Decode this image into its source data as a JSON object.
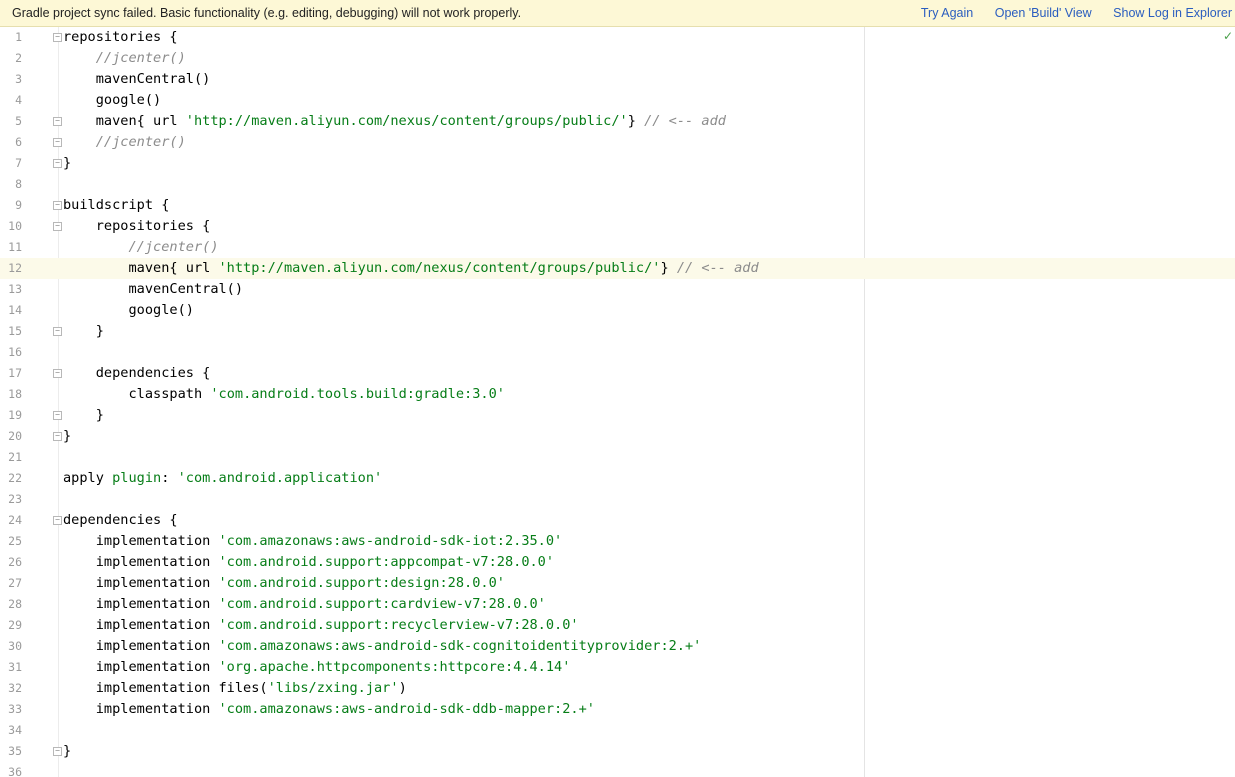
{
  "banner": {
    "message": "Gradle project sync failed. Basic functionality (e.g. editing, debugging) will not work properly.",
    "try_again": "Try Again",
    "open_build": "Open 'Build' View",
    "show_log": "Show Log in Explorer"
  },
  "editor": {
    "current_line": 12,
    "lines": [
      {
        "n": "1",
        "segs": [
          [
            "p",
            "repositories {"
          ]
        ]
      },
      {
        "n": "2",
        "segs": [
          [
            "p",
            "    "
          ],
          [
            "c",
            "//jcenter()"
          ]
        ]
      },
      {
        "n": "3",
        "segs": [
          [
            "p",
            "    mavenCentral()"
          ]
        ]
      },
      {
        "n": "4",
        "segs": [
          [
            "p",
            "    google()"
          ]
        ]
      },
      {
        "n": "5",
        "segs": [
          [
            "p",
            "    maven{ url "
          ],
          [
            "s",
            "'http://maven.aliyun.com/nexus/content/groups/public/'"
          ],
          [
            "p",
            "} "
          ],
          [
            "c",
            "// <-- add"
          ]
        ]
      },
      {
        "n": "6",
        "segs": [
          [
            "p",
            "    "
          ],
          [
            "c",
            "//jcenter()"
          ]
        ]
      },
      {
        "n": "7",
        "segs": [
          [
            "p",
            "}"
          ]
        ]
      },
      {
        "n": "8",
        "segs": []
      },
      {
        "n": "9",
        "segs": [
          [
            "p",
            "buildscript {"
          ]
        ]
      },
      {
        "n": "10",
        "segs": [
          [
            "p",
            "    repositories {"
          ]
        ]
      },
      {
        "n": "11",
        "segs": [
          [
            "p",
            "        "
          ],
          [
            "c",
            "//jcenter()"
          ]
        ]
      },
      {
        "n": "12",
        "segs": [
          [
            "p",
            "        maven{ url "
          ],
          [
            "s",
            "'http://maven.aliyun.com/nexus/content/groups/public/'"
          ],
          [
            "p",
            "} "
          ],
          [
            "c",
            "// <-- add"
          ]
        ]
      },
      {
        "n": "13",
        "segs": [
          [
            "p",
            "        mavenCentral()"
          ]
        ]
      },
      {
        "n": "14",
        "segs": [
          [
            "p",
            "        google()"
          ]
        ]
      },
      {
        "n": "15",
        "segs": [
          [
            "p",
            "    }"
          ]
        ]
      },
      {
        "n": "16",
        "segs": []
      },
      {
        "n": "17",
        "segs": [
          [
            "p",
            "    dependencies {"
          ]
        ]
      },
      {
        "n": "18",
        "segs": [
          [
            "p",
            "        classpath "
          ],
          [
            "s",
            "'com.android.tools.build:gradle:3.0'"
          ]
        ]
      },
      {
        "n": "19",
        "segs": [
          [
            "p",
            "    }"
          ]
        ]
      },
      {
        "n": "20",
        "segs": [
          [
            "p",
            "}"
          ]
        ]
      },
      {
        "n": "21",
        "segs": []
      },
      {
        "n": "22",
        "segs": [
          [
            "p",
            "apply "
          ],
          [
            "g",
            "plugin"
          ],
          [
            "p",
            ": "
          ],
          [
            "s",
            "'com.android.application'"
          ]
        ]
      },
      {
        "n": "23",
        "segs": []
      },
      {
        "n": "24",
        "segs": [
          [
            "p",
            "dependencies {"
          ]
        ]
      },
      {
        "n": "25",
        "segs": [
          [
            "p",
            "    implementation "
          ],
          [
            "s",
            "'com.amazonaws:aws-android-sdk-iot:2.35.0'"
          ]
        ]
      },
      {
        "n": "26",
        "segs": [
          [
            "p",
            "    implementation "
          ],
          [
            "s",
            "'com.android.support:appcompat-v7:28.0.0'"
          ]
        ]
      },
      {
        "n": "27",
        "segs": [
          [
            "p",
            "    implementation "
          ],
          [
            "s",
            "'com.android.support:design:28.0.0'"
          ]
        ]
      },
      {
        "n": "28",
        "segs": [
          [
            "p",
            "    implementation "
          ],
          [
            "s",
            "'com.android.support:cardview-v7:28.0.0'"
          ]
        ]
      },
      {
        "n": "29",
        "segs": [
          [
            "p",
            "    implementation "
          ],
          [
            "s",
            "'com.android.support:recyclerview-v7:28.0.0'"
          ]
        ]
      },
      {
        "n": "30",
        "segs": [
          [
            "p",
            "    implementation "
          ],
          [
            "s",
            "'com.amazonaws:aws-android-sdk-cognitoidentityprovider:2.+'"
          ]
        ]
      },
      {
        "n": "31",
        "segs": [
          [
            "p",
            "    implementation "
          ],
          [
            "s",
            "'org.apache.httpcomponents:httpcore:4.4.14'"
          ]
        ]
      },
      {
        "n": "32",
        "segs": [
          [
            "p",
            "    implementation files("
          ],
          [
            "s",
            "'libs/zxing.jar'"
          ],
          [
            "p",
            ")"
          ]
        ]
      },
      {
        "n": "33",
        "segs": [
          [
            "p",
            "    implementation "
          ],
          [
            "s",
            "'com.amazonaws:aws-android-sdk-ddb-mapper:2.+'"
          ]
        ]
      },
      {
        "n": "34",
        "segs": []
      },
      {
        "n": "35",
        "segs": [
          [
            "p",
            "}"
          ]
        ]
      },
      {
        "n": "36",
        "segs": []
      }
    ],
    "fold_markers": [
      "1",
      "5",
      "6",
      "7",
      "9",
      "10",
      "15",
      "17",
      "19",
      "20",
      "24",
      "35"
    ]
  }
}
